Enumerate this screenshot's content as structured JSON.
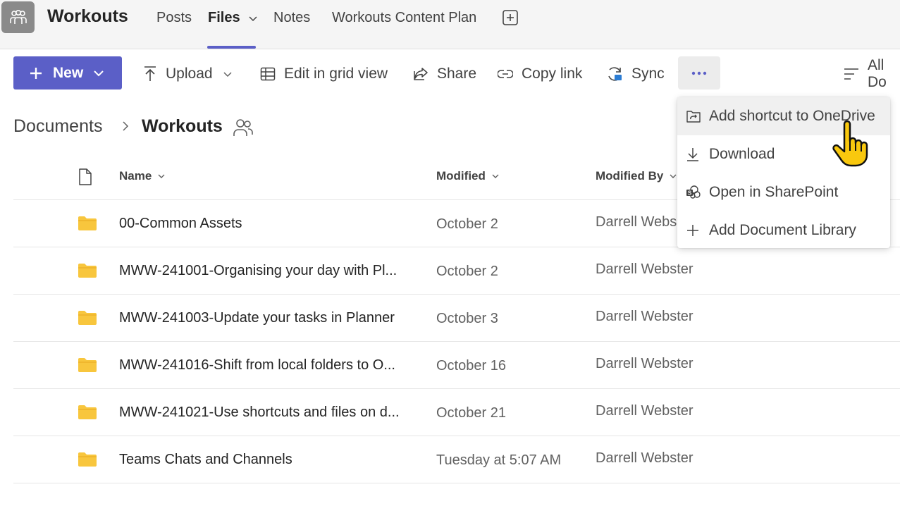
{
  "header": {
    "team_name": "Workouts",
    "tabs": [
      {
        "label": "Posts"
      },
      {
        "label": "Files"
      },
      {
        "label": "Notes"
      },
      {
        "label": "Workouts Content Plan"
      }
    ]
  },
  "toolbar": {
    "new_label": "New",
    "upload_label": "Upload",
    "grid_label": "Edit in grid view",
    "share_label": "Share",
    "copy_link_label": "Copy link",
    "sync_label": "Sync",
    "view_label": "All Do"
  },
  "breadcrumb": {
    "root": "Documents",
    "current": "Workouts"
  },
  "table": {
    "columns": {
      "name": "Name",
      "modified": "Modified",
      "modified_by": "Modified By"
    },
    "rows": [
      {
        "name": "00-Common Assets",
        "modified": "October 2",
        "modified_by": "Darrell Webs"
      },
      {
        "name": "MWW-241001-Organising your day with Pl...",
        "modified": "October 2",
        "modified_by": "Darrell Webster"
      },
      {
        "name": "MWW-241003-Update your tasks in Planner",
        "modified": "October 3",
        "modified_by": "Darrell Webster"
      },
      {
        "name": "MWW-241016-Shift from local folders to O...",
        "modified": "October 16",
        "modified_by": "Darrell Webster"
      },
      {
        "name": "MWW-241021-Use shortcuts and files on d...",
        "modified": "October 21",
        "modified_by": "Darrell Webster"
      },
      {
        "name": "Teams Chats and Channels",
        "modified": "Tuesday at 5:07 AM",
        "modified_by": "Darrell Webster"
      }
    ]
  },
  "menu": {
    "items": [
      {
        "label": "Add shortcut to OneDrive",
        "icon": "shortcut-icon"
      },
      {
        "label": "Download",
        "icon": "download-icon"
      },
      {
        "label": "Open in SharePoint",
        "icon": "sharepoint-icon"
      },
      {
        "label": "Add Document Library",
        "icon": "plus-icon"
      }
    ]
  },
  "colors": {
    "accent": "#5b5fc7",
    "folder": "#f8c63d",
    "header_bg": "#f5f5f5"
  }
}
